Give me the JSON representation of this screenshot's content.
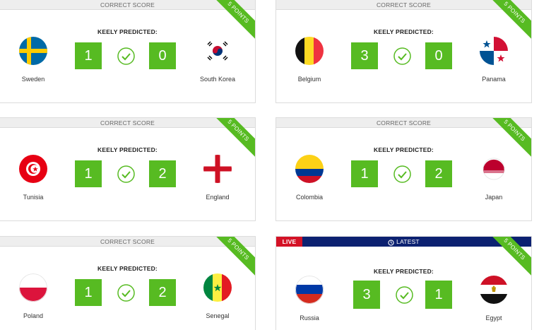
{
  "cards": [
    {
      "header": "CORRECT SCORE",
      "ribbon": "5 POINTS",
      "predicted_label": "KEELY PREDICTED:",
      "home": {
        "name": "Sweden",
        "score": "1",
        "flag": "sweden-flag"
      },
      "away": {
        "name": "South Korea",
        "score": "0",
        "flag": "south-korea-flag"
      }
    },
    {
      "header": "CORRECT SCORE",
      "ribbon": "5 POINTS",
      "predicted_label": "KEELY PREDICTED:",
      "home": {
        "name": "Belgium",
        "score": "3",
        "flag": "belgium-flag"
      },
      "away": {
        "name": "Panama",
        "score": "0",
        "flag": "panama-flag"
      }
    },
    {
      "header": "CORRECT SCORE",
      "ribbon": "5 POINTS",
      "predicted_label": "KEELY PREDICTED:",
      "home": {
        "name": "Tunisia",
        "score": "1",
        "flag": "tunisia-flag"
      },
      "away": {
        "name": "England",
        "score": "2",
        "flag": "england-flag"
      }
    },
    {
      "header": "CORRECT SCORE",
      "ribbon": "5 POINTS",
      "predicted_label": "KEELY PREDICTED:",
      "home": {
        "name": "Colombia",
        "score": "1",
        "flag": "colombia-flag"
      },
      "away": {
        "name": "Japan",
        "score": "2",
        "flag": "japan-flag"
      }
    },
    {
      "header": "CORRECT SCORE",
      "ribbon": "5 POINTS",
      "predicted_label": "KEELY PREDICTED:",
      "home": {
        "name": "Poland",
        "score": "1",
        "flag": "poland-flag"
      },
      "away": {
        "name": "Senegal",
        "score": "2",
        "flag": "senegal-flag"
      }
    },
    {
      "live_tag": "LIVE",
      "header": "LATEST",
      "ribbon": "5 POINTS",
      "predicted_label": "KEELY PREDICTED:",
      "home": {
        "name": "Russia",
        "score": "3",
        "flag": "russia-flag"
      },
      "away": {
        "name": "Egypt",
        "score": "1",
        "flag": "egypt-flag"
      }
    }
  ],
  "colors": {
    "accent_green": "#57bb22",
    "live_red": "#d41226",
    "live_navy": "#0c2171",
    "header_grey": "#eeeeee"
  }
}
